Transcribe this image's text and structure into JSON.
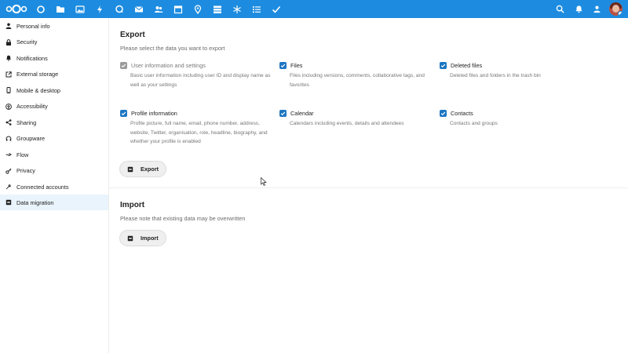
{
  "colors": {
    "header_bg": "#1d8ce0",
    "accent": "#1d77c1",
    "active_nav_bg": "#e9f4fc"
  },
  "header": {
    "apps": [
      "dashboard-icon",
      "files-icon",
      "photos-icon",
      "activity-icon",
      "talk-icon",
      "mail-icon",
      "contacts-icon",
      "calendar-icon",
      "maps-icon",
      "deck-icon",
      "circles-icon",
      "notes-icon",
      "tasks-icon"
    ],
    "right": [
      "search-icon",
      "notifications-icon",
      "contacts-menu-icon",
      "user-avatar"
    ]
  },
  "sidebar": {
    "items": [
      {
        "label": "Personal info",
        "icon": "user-icon"
      },
      {
        "label": "Security",
        "icon": "lock-icon"
      },
      {
        "label": "Notifications",
        "icon": "bell-icon"
      },
      {
        "label": "External storage",
        "icon": "external-link-icon"
      },
      {
        "label": "Mobile & desktop",
        "icon": "phone-icon"
      },
      {
        "label": "Accessibility",
        "icon": "accessibility-icon"
      },
      {
        "label": "Sharing",
        "icon": "share-icon"
      },
      {
        "label": "Groupware",
        "icon": "groupware-icon"
      },
      {
        "label": "Flow",
        "icon": "flow-icon"
      },
      {
        "label": "Privacy",
        "icon": "privacy-key-icon"
      },
      {
        "label": "Connected accounts",
        "icon": "wrench-icon"
      },
      {
        "label": "Data migration",
        "icon": "database-icon",
        "active": true
      }
    ]
  },
  "export": {
    "title": "Export",
    "hint": "Please select the data you want to export",
    "options": [
      {
        "label": "User information and settings",
        "checked": true,
        "disabled": true,
        "desc": "Basic user information including user ID and display name as well as your settings"
      },
      {
        "label": "Files",
        "checked": true,
        "disabled": false,
        "desc": "Files including versions, comments, collaborative tags, and favorites"
      },
      {
        "label": "Deleted files",
        "checked": true,
        "disabled": false,
        "desc": "Deleted files and folders in the trash bin"
      },
      {
        "label": "Profile information",
        "checked": true,
        "disabled": false,
        "desc": "Profile picture, full name, email, phone number, address, website, Twitter, organisation, role, headline, biography, and whether your profile is enabled"
      },
      {
        "label": "Calendar",
        "checked": true,
        "disabled": false,
        "desc": "Calendars including events, details and attendees"
      },
      {
        "label": "Contacts",
        "checked": true,
        "disabled": false,
        "desc": "Contacts and groups"
      }
    ],
    "button_label": "Export"
  },
  "import": {
    "title": "Import",
    "hint": "Please note that existing data may be overwritten",
    "button_label": "Import"
  }
}
